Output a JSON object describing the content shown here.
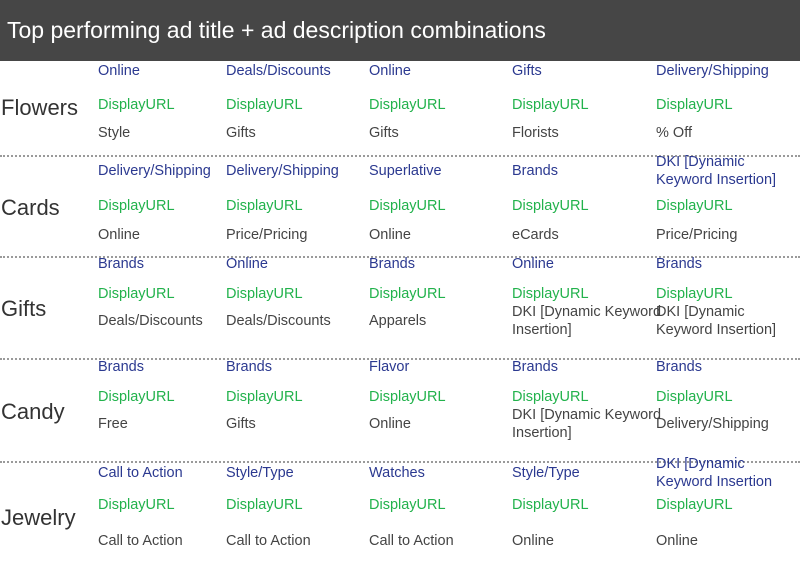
{
  "header": {
    "title": "Top performing ad title + ad description combinations"
  },
  "categories": [
    {
      "name": "Flowers",
      "titles": [
        "Online",
        "Deals/Discounts",
        "Online",
        "Gifts",
        "Delivery/Shipping"
      ],
      "urls": [
        "DisplayURL",
        "DisplayURL",
        "DisplayURL",
        "DisplayURL",
        "DisplayURL"
      ],
      "descriptions": [
        "Style",
        "Gifts",
        "Gifts",
        "Florists",
        "% Off"
      ]
    },
    {
      "name": "Cards",
      "titles": [
        "Delivery/Shipping",
        "Delivery/Shipping",
        "Superlative",
        "Brands",
        "DKI [Dynamic Keyword Insertion]"
      ],
      "urls": [
        "DisplayURL",
        "DisplayURL",
        "DisplayURL",
        "DisplayURL",
        "DisplayURL"
      ],
      "descriptions": [
        "Online",
        "Price/Pricing",
        "Online",
        "eCards",
        "Price/Pricing"
      ]
    },
    {
      "name": "Gifts",
      "titles": [
        "Brands",
        "Online",
        "Brands",
        "Online",
        "Brands"
      ],
      "urls": [
        "DisplayURL",
        "DisplayURL",
        "DisplayURL",
        "DisplayURL",
        "DisplayURL"
      ],
      "descriptions": [
        "Deals/Discounts",
        "Deals/Discounts",
        "Apparels",
        "DKI [Dynamic Keyword Insertion]",
        "DKI [Dynamic Keyword Insertion]"
      ]
    },
    {
      "name": "Candy",
      "titles": [
        "Brands",
        "Brands",
        "Flavor",
        "Brands",
        "Brands"
      ],
      "urls": [
        "DisplayURL",
        "DisplayURL",
        "DisplayURL",
        "DisplayURL",
        "DisplayURL"
      ],
      "descriptions": [
        "Free",
        "Gifts",
        "Online",
        "DKI [Dynamic Keyword Insertion]",
        "Delivery/Shipping"
      ]
    },
    {
      "name": "Jewelry",
      "titles": [
        "Call to Action",
        "Style/Type",
        "Watches",
        "Style/Type",
        "DKI [Dynamic Keyword Insertion"
      ],
      "urls": [
        "DisplayURL",
        "DisplayURL",
        "DisplayURL",
        "DisplayURL",
        "DisplayURL"
      ],
      "descriptions": [
        "Call to Action",
        "Call to Action",
        "Call to Action",
        "Online",
        "Online"
      ]
    }
  ]
}
